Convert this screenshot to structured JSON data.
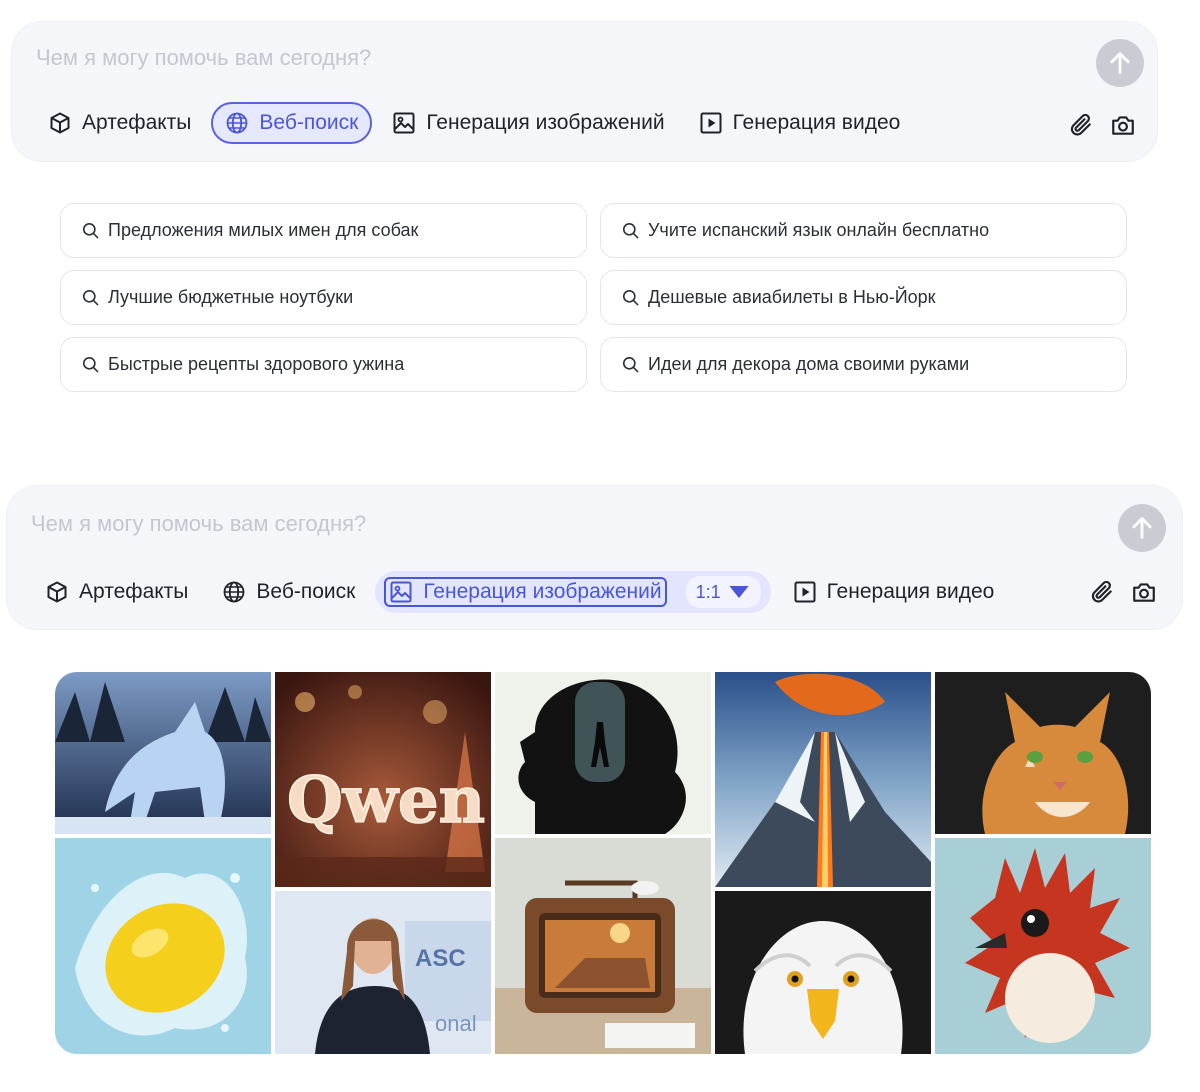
{
  "composer_web": {
    "placeholder": "Чем я могу помочь вам сегодня?",
    "tools": {
      "artifacts": "Артефакты",
      "web_search": "Веб-поиск",
      "image_gen": "Генерация изображений",
      "video_gen": "Генерация видео"
    },
    "active_tool": "web_search"
  },
  "suggestions": [
    "Предложения милых имен для собак",
    "Учите испанский язык онлайн бесплатно",
    "Лучшие бюджетные ноутбуки",
    "Дешевые авиабилеты в Нью-Йорк",
    "Быстрые рецепты здорового ужина",
    "Идеи для декора дома своими руками"
  ],
  "composer_image": {
    "placeholder": "Чем я могу помочь вам сегодня?",
    "tools": {
      "artifacts": "Артефакты",
      "web_search": "Веб-поиск",
      "image_gen": "Генерация изображений",
      "video_gen": "Генерация видео"
    },
    "aspect_ratio": "1:1",
    "active_tool": "image_gen"
  },
  "gallery_text": {
    "qwen_sign": "Qwen",
    "slide_text": "ASC",
    "slide_text_2": "onal"
  },
  "colors": {
    "accent": "#4a56d8",
    "composer_bg": "#f5f6fa",
    "send_button": "#c9ccd3",
    "placeholder": "#c3c7d0"
  },
  "icons": {
    "artifacts": "cube-icon",
    "web_search": "globe-icon",
    "image_gen": "image-icon",
    "video_gen": "play-square-icon",
    "attach": "paperclip-icon",
    "camera": "camera-icon",
    "send": "arrow-up-icon",
    "suggestion": "search-icon"
  }
}
